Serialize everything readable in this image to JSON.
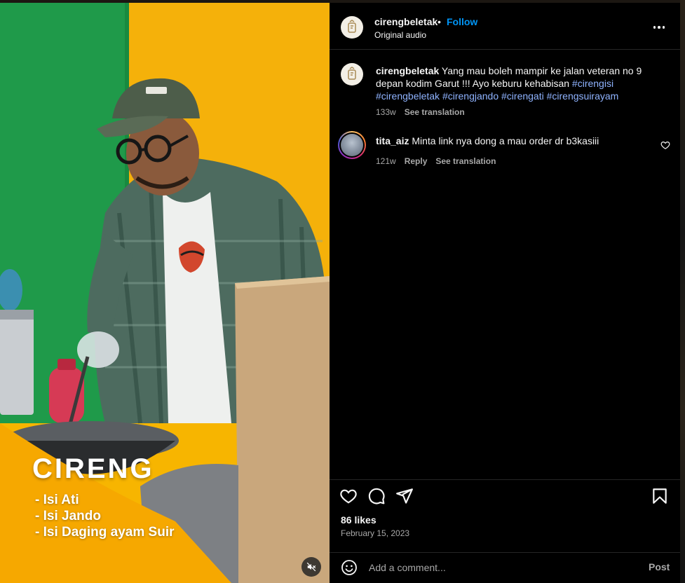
{
  "post": {
    "username": "cirengbeletak",
    "separator": "•",
    "follow_label": "Follow",
    "audio_label": "Original audio"
  },
  "media": {
    "caption_title": "CIRENG",
    "caption_items": [
      "- Isi Ati",
      "- Isi Jando",
      "- Isi Daging ayam Suir"
    ],
    "mute_icon": "speaker-muted-icon"
  },
  "caption_comment": {
    "username": "cirengbeletak",
    "text": "Yang mau boleh mampir ke jalan veteran no 9 depan kodim Garut !!! Ayo keburu kehabisan",
    "hashtags": [
      "#cirengisi",
      "#cirengbeletak",
      "#cirengjando",
      "#cirengati",
      "#cirengsuirayam"
    ],
    "age": "133w",
    "see_translation": "See translation"
  },
  "comments": [
    {
      "username": "tita_aiz",
      "text": "Minta link nya dong a mau order dr b3kasiii",
      "age": "121w",
      "reply": "Reply",
      "see_translation": "See translation"
    }
  ],
  "stats": {
    "likes": "86 likes",
    "date": "February 15, 2023"
  },
  "composer": {
    "placeholder": "Add a comment...",
    "post_label": "Post"
  },
  "colors": {
    "panel_bg": "#000000",
    "follow_blue": "#0095f6",
    "hashtag": "#8fb3ff",
    "muted_text": "#a8a8a8",
    "wall_green": "#1f9a4a",
    "wall_yellow": "#f7b500"
  }
}
